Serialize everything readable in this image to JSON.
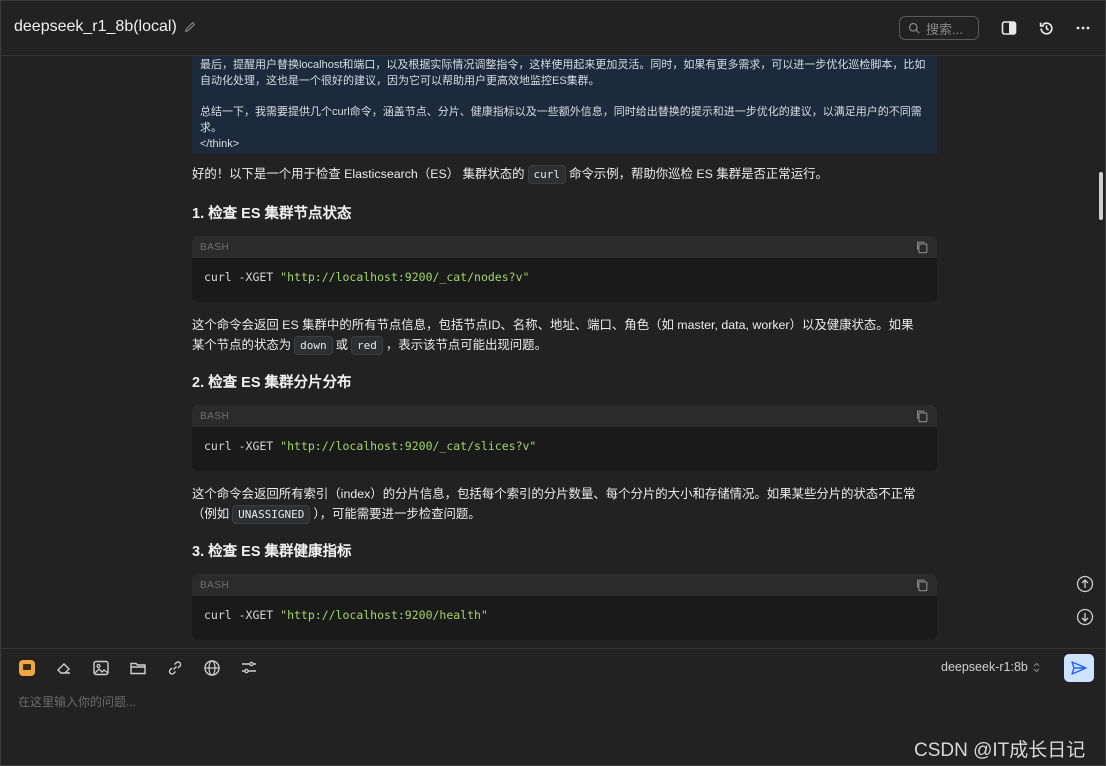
{
  "header": {
    "title": "deepseek_r1_8b(local)",
    "search_placeholder": "搜索..."
  },
  "think": {
    "para1": "最后，提醒用户替换localhost和端口，以及根据实际情况调整指令，这样使用起来更加灵活。同时，如果有更多需求，可以进一步优化巡检脚本，比如自动化处理，这也是一个很好的建议，因为它可以帮助用户更高效地监控ES集群。",
    "para2": "总结一下，我需要提供几个curl命令，涵盖节点、分片、健康指标以及一些额外信息，同时给出替换的提示和进一步优化的建议，以满足用户的不同需求。",
    "close_tag": "</think>"
  },
  "intro": {
    "before": "好的！以下是一个用于检查 Elasticsearch（ES） 集群状态的",
    "code": "curl",
    "after": "命令示例，帮助你巡检 ES 集群是否正常运行。"
  },
  "sections": [
    {
      "heading": "1. 检查 ES 集群节点状态",
      "lang": "BASH",
      "cmd": "curl -XGET ",
      "url": "\"http://localhost:9200/_cat/nodes?v\"",
      "desc_line1": "这个命令会返回 ES 集群中的所有节点信息，包括节点ID、名称、地址、端口、角色（如 master, data, worker）以及健康状态。如果",
      "desc_pre": "某个节点的状态为",
      "code_a": "down",
      "desc_mid": "或",
      "code_b": "red",
      "desc_post": "，表示该节点可能出现问题。"
    },
    {
      "heading": "2. 检查 ES 集群分片分布",
      "lang": "BASH",
      "cmd": "curl -XGET ",
      "url": "\"http://localhost:9200/_cat/slices?v\"",
      "desc_line1": "这个命令会返回所有索引（index）的分片信息，包括每个索引的分片数量、每个分片的大小和存储情况。如果某些分片的状态不正常",
      "desc_pre": "（例如",
      "code_a": "UNASSIGNED",
      "desc_post": "），可能需要进一步检查问题。"
    },
    {
      "heading": "3. 检查 ES 集群健康指标",
      "lang": "BASH",
      "cmd": "curl -XGET ",
      "url": "\"http://localhost:9200/health\""
    }
  ],
  "input": {
    "model_name": "deepseek-r1:8b",
    "placeholder": "在这里输入你的问题..."
  },
  "watermark": "CSDN @IT成长日记",
  "colors": {
    "background": "#222223",
    "think_bg": "#1d2a3b",
    "string_green": "#a7d36a",
    "send_bg": "#cfe2ff",
    "active_tool": "#f0a540"
  }
}
